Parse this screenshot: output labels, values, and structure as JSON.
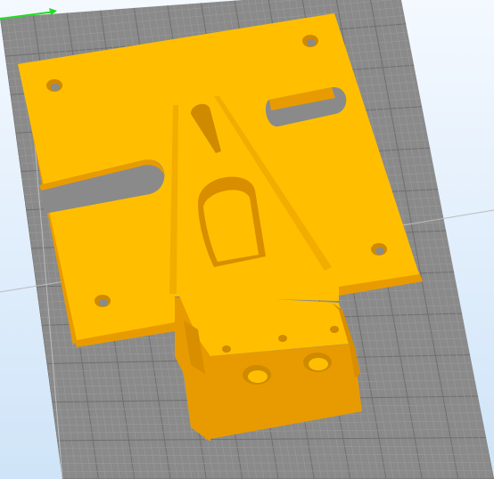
{
  "viewport": {
    "background_top": "#f4f9ff",
    "background_bottom": "#cfe4f8"
  },
  "build_plate": {
    "fill_color": "#8a8a8a",
    "fine_grid_color": "#9a9a9a",
    "major_grid_color": "#6f6f6f"
  },
  "model": {
    "face_color": "#ffbf00",
    "side_color": "#e89b00",
    "shade_color": "#d98e00",
    "rib_color": "#f2ad00",
    "hole_color": "#cf8a00"
  },
  "axes": {
    "x_axis_color": "#22dd22",
    "guide_line_color": "#bcbcbc"
  }
}
